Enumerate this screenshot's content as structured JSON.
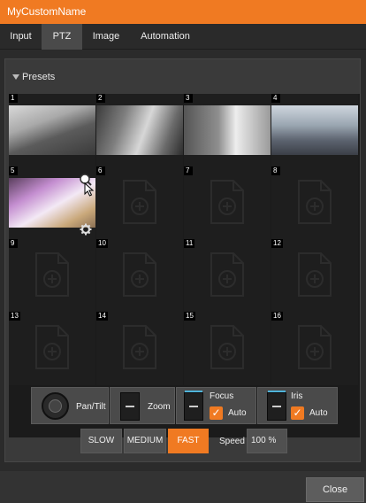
{
  "window": {
    "title": "MyCustomName"
  },
  "tabs": [
    {
      "label": "Input",
      "active": false
    },
    {
      "label": "PTZ",
      "active": true
    },
    {
      "label": "Image",
      "active": false
    },
    {
      "label": "Automation",
      "active": false
    }
  ],
  "presets": {
    "header": "Presets",
    "items": [
      {
        "number": "1",
        "has_image": true
      },
      {
        "number": "2",
        "has_image": true
      },
      {
        "number": "3",
        "has_image": true
      },
      {
        "number": "4",
        "has_image": true
      },
      {
        "number": "5",
        "has_image": true
      },
      {
        "number": "6",
        "has_image": false
      },
      {
        "number": "7",
        "has_image": false
      },
      {
        "number": "8",
        "has_image": false
      },
      {
        "number": "9",
        "has_image": false
      },
      {
        "number": "10",
        "has_image": false
      },
      {
        "number": "11",
        "has_image": false
      },
      {
        "number": "12",
        "has_image": false
      },
      {
        "number": "13",
        "has_image": false
      },
      {
        "number": "14",
        "has_image": false
      },
      {
        "number": "15",
        "has_image": false
      },
      {
        "number": "16",
        "has_image": false
      }
    ]
  },
  "controls": {
    "pan_tilt": "Pan/Tilt",
    "zoom": "Zoom",
    "focus": "Focus",
    "focus_auto": "Auto",
    "iris": "Iris",
    "iris_auto": "Auto"
  },
  "speed": {
    "slow": "SLOW",
    "medium": "MEDIUM",
    "fast": "FAST",
    "label": "Speed",
    "value": "100 %"
  },
  "footer": {
    "close": "Close"
  },
  "colors": {
    "accent": "#f07a22",
    "highlight": "#4fb3d9"
  }
}
